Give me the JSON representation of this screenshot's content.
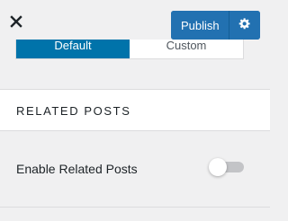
{
  "header": {
    "close_icon": "close-icon",
    "publish_label": "Publish",
    "settings_icon": "gear-icon"
  },
  "layout_switch": {
    "options": [
      "Default",
      "Custom"
    ],
    "selected": "Default"
  },
  "section": {
    "title": "RELATED POSTS"
  },
  "settings": {
    "enable_related_posts": {
      "label": "Enable Related Posts",
      "enabled": false
    }
  },
  "colors": {
    "accent": "#2271b1",
    "segment_active": "#0073aa",
    "background": "#f0f0f1",
    "toggle_off": "#c3c4c7"
  }
}
